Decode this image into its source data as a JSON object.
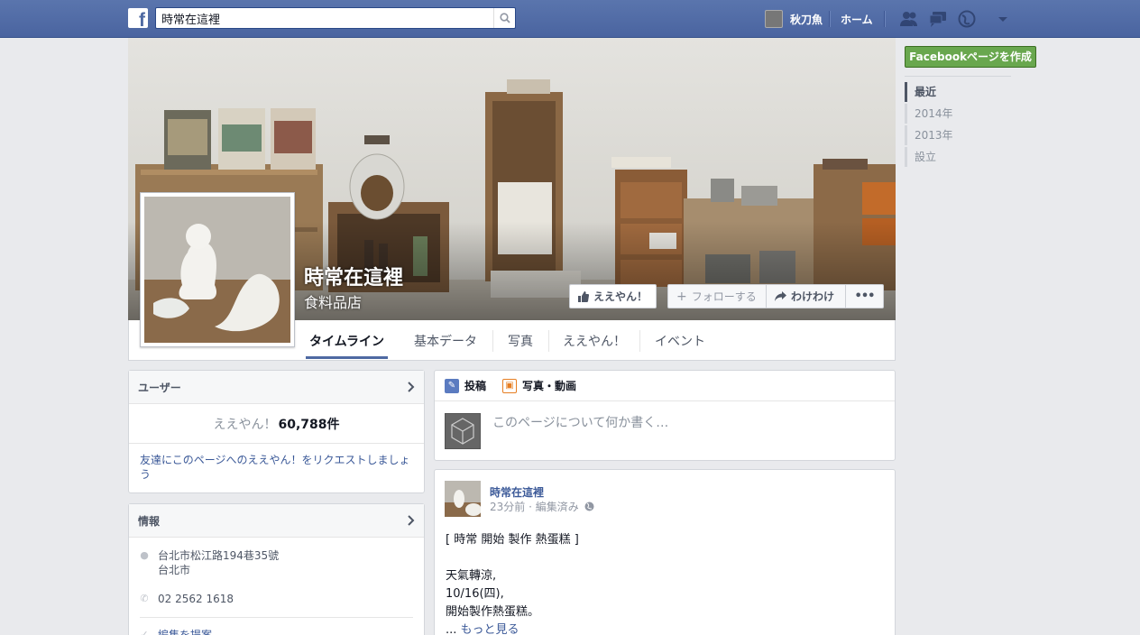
{
  "topbar": {
    "search_value": "時常在這裡",
    "user_name": "秋刀魚",
    "home_label": "ホーム",
    "icons": [
      "friends-icon",
      "messages-icon",
      "notifications-icon",
      "account-dropdown-icon"
    ]
  },
  "page": {
    "name": "時常在這裡",
    "category": "食料品店"
  },
  "cover_buttons": {
    "like": "ええやん！",
    "follow": "フォローする",
    "share": "わけわけ",
    "more": "•••"
  },
  "tabs": [
    "タイムライン",
    "基本データ",
    "写真",
    "ええやん！",
    "イベント"
  ],
  "active_tab": "タイムライン",
  "right_sidebar": {
    "create_button": "Facebookページを作成",
    "years": [
      "最近",
      "2014年",
      "2013年",
      "設立"
    ]
  },
  "users_card": {
    "title": "ユーザー",
    "likes_label": "ええやん！",
    "likes_count": "60,788件",
    "request_text": "友達にこのページへのええやん！をリクエストしましょう"
  },
  "info_card": {
    "title": "情報",
    "address_line1": "台北市松江路194巷35號",
    "address_line2": "台北市",
    "phone": "02 2562 1618",
    "edit_suggest": "編集を提案"
  },
  "composer": {
    "tab_post": "投稿",
    "tab_photo": "写真・動画",
    "placeholder": "このページについて何か書く…"
  },
  "post": {
    "author": "時常在這裡",
    "meta": "23分前 · 編集済み",
    "line1": "[ 時常 開始 製作 熱蛋糕 ]",
    "line2": "天氣轉涼,",
    "line3": "10/16(四),",
    "line4": "開始製作熱蛋糕。",
    "ellipsis": "...",
    "see_more": "もっと見る"
  },
  "colors": {
    "fb_blue": "#4e69a2",
    "link": "#3b5998",
    "create_green": "#69a74e"
  }
}
